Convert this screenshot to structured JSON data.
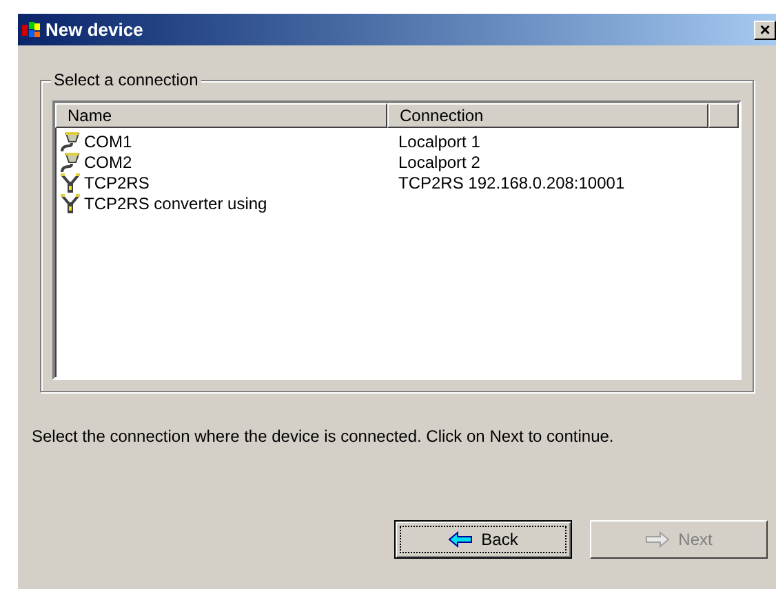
{
  "window": {
    "title": "New device",
    "close": "×"
  },
  "group": {
    "title": "Select a connection"
  },
  "table": {
    "columns": [
      "Name",
      "Connection"
    ],
    "rows": [
      {
        "kind": "serial",
        "name": "COM1",
        "connection": "Localport 1"
      },
      {
        "kind": "serial",
        "name": "COM2",
        "connection": "Localport 2"
      },
      {
        "kind": "tcp",
        "name": "TCP2RS",
        "connection": "TCP2RS 192.168.0.208:10001"
      },
      {
        "kind": "tcp",
        "name": "TCP2RS converter using"
      }
    ]
  },
  "instruction": "Select the connection where the device is connected. Click on Next to continue.",
  "buttons": [
    {
      "kind": "back",
      "label": "Back",
      "disabled": false,
      "focused": true
    },
    {
      "kind": "next",
      "label": "Next",
      "disabled": true,
      "focused": false
    }
  ]
}
